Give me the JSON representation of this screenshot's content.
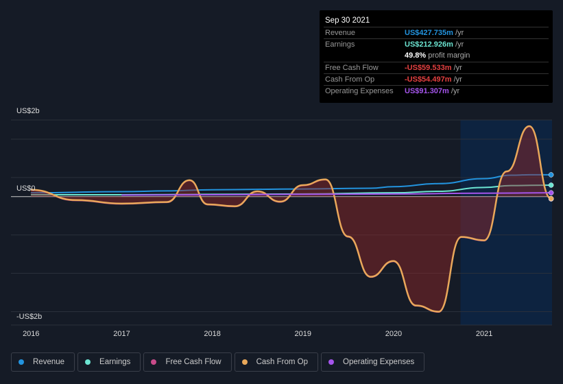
{
  "tooltip": {
    "date": "Sep 30 2021",
    "rows": [
      {
        "label": "Revenue",
        "value": "US$427.735m",
        "unit": "/yr",
        "color": "#2394df"
      },
      {
        "label": "Earnings",
        "value": "US$212.926m",
        "unit": "/yr",
        "color": "#6ce5d2"
      },
      {
        "label": "",
        "value": "49.8%",
        "unit": "profit margin",
        "color": "#ffffff"
      },
      {
        "label": "Free Cash Flow",
        "value": "-US$59.533m",
        "unit": "/yr",
        "color": "#e64141"
      },
      {
        "label": "Cash From Op",
        "value": "-US$54.497m",
        "unit": "/yr",
        "color": "#e64141"
      },
      {
        "label": "Operating Expenses",
        "value": "US$91.307m",
        "unit": "/yr",
        "color": "#a555ec"
      }
    ]
  },
  "chart_data": {
    "type": "line",
    "ylabels": {
      "top": "US$2b",
      "zero": "US$0",
      "bottom": "-US$2b"
    },
    "ylim": [
      -3.35,
      2
    ],
    "xlim": [
      2015.78,
      2021.75
    ],
    "xticks": [
      "2016",
      "2017",
      "2018",
      "2019",
      "2020",
      "2021"
    ],
    "highlight_from": 2020.74,
    "series": [
      {
        "name": "Revenue",
        "color": "#2394df",
        "x": [
          2016,
          2017,
          2017.5,
          2018,
          2019,
          2019.75,
          2020,
          2020.5,
          2021,
          2021.3,
          2021.5,
          2021.74
        ],
        "values": [
          0.1,
          0.13,
          0.15,
          0.18,
          0.2,
          0.22,
          0.26,
          0.34,
          0.47,
          0.56,
          0.57,
          0.57
        ]
      },
      {
        "name": "Earnings",
        "color": "#6ce5d2",
        "x": [
          2016,
          2017,
          2018,
          2019,
          2020,
          2020.5,
          2021,
          2021.3,
          2021.74
        ],
        "values": [
          0.05,
          0.05,
          0.06,
          0.07,
          0.1,
          0.14,
          0.24,
          0.29,
          0.3
        ]
      },
      {
        "name": "Free Cash Flow",
        "color": "#c84b8a",
        "x": [
          2016,
          2016.5,
          2017,
          2017.5,
          2017.75,
          2017.95,
          2018.25,
          2018.5,
          2018.75,
          2019,
          2019.25,
          2019.5,
          2019.75,
          2020,
          2020.25,
          2020.5,
          2020.75,
          2021,
          2021.25,
          2021.5,
          2021.74
        ],
        "values": [
          0.17,
          -0.1,
          -0.19,
          -0.15,
          0.42,
          -0.21,
          -0.26,
          0.13,
          -0.14,
          0.29,
          0.44,
          -1.05,
          -2.1,
          -1.69,
          -2.85,
          -3.01,
          -1.06,
          -1.15,
          0.65,
          1.83,
          -0.06
        ]
      },
      {
        "name": "Cash From Op",
        "color": "#e9a85a",
        "x": [
          2016,
          2016.5,
          2017,
          2017.5,
          2017.75,
          2017.95,
          2018.25,
          2018.5,
          2018.75,
          2019,
          2019.25,
          2019.5,
          2019.75,
          2020,
          2020.25,
          2020.5,
          2020.75,
          2021,
          2021.25,
          2021.5,
          2021.74
        ],
        "values": [
          0.18,
          -0.09,
          -0.18,
          -0.14,
          0.43,
          -0.2,
          -0.25,
          0.14,
          -0.13,
          0.3,
          0.45,
          -1.04,
          -2.09,
          -1.68,
          -2.84,
          -3.0,
          -1.05,
          -1.14,
          0.66,
          1.84,
          -0.05
        ]
      },
      {
        "name": "Operating Expenses",
        "color": "#a555ec",
        "x": [
          2017,
          2018,
          2019,
          2020,
          2021,
          2021.74
        ],
        "values": [
          0.04,
          0.05,
          0.06,
          0.07,
          0.09,
          0.1
        ]
      }
    ]
  }
}
